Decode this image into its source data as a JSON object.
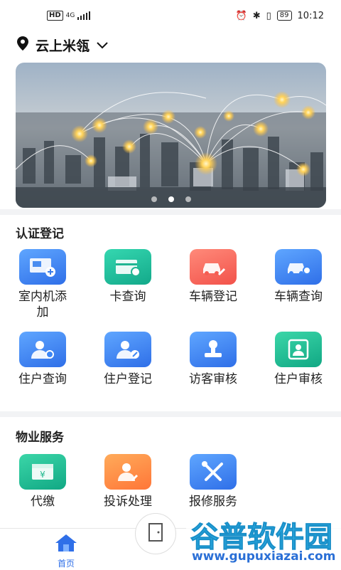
{
  "status_bar": {
    "hd": "HD",
    "network": "4G",
    "battery": "89",
    "time": "10:12"
  },
  "location": {
    "name": "云上米瓴"
  },
  "banner": {
    "dots": 3,
    "active_dot": 1
  },
  "sections": [
    {
      "title": "认证登记",
      "items": [
        {
          "label": "室内机添加",
          "icon": "monitor-plus-icon",
          "color": "blue"
        },
        {
          "label": "卡查询",
          "icon": "card-search-icon",
          "color": "teal"
        },
        {
          "label": "车辆登记",
          "icon": "car-edit-icon",
          "color": "red"
        },
        {
          "label": "车辆查询",
          "icon": "car-search-icon",
          "color": "blue"
        },
        {
          "label": "住户查询",
          "icon": "resident-search-icon",
          "color": "blue"
        },
        {
          "label": "住户登记",
          "icon": "resident-edit-icon",
          "color": "blue"
        },
        {
          "label": "访客审核",
          "icon": "stamp-icon",
          "color": "blue"
        },
        {
          "label": "住户审核",
          "icon": "resident-review-icon",
          "color": "green"
        }
      ]
    },
    {
      "title": "物业服务",
      "items": [
        {
          "label": "代缴",
          "icon": "wallet-yen-icon",
          "color": "green"
        },
        {
          "label": "投诉处理",
          "icon": "complaint-icon",
          "color": "orange"
        },
        {
          "label": "报修服务",
          "icon": "repair-tools-icon",
          "color": "blue"
        }
      ]
    }
  ],
  "tabbar": {
    "home_label": "首页"
  },
  "watermark": {
    "title": "谷普软件园",
    "url": "www.gupuxiazai.com"
  },
  "colors": {
    "accent": "#2f6fe8",
    "blue": "#3d86f5",
    "teal": "#1fbf9a",
    "red": "#f45d52",
    "orange": "#ff8a45",
    "green": "#20b88e"
  }
}
